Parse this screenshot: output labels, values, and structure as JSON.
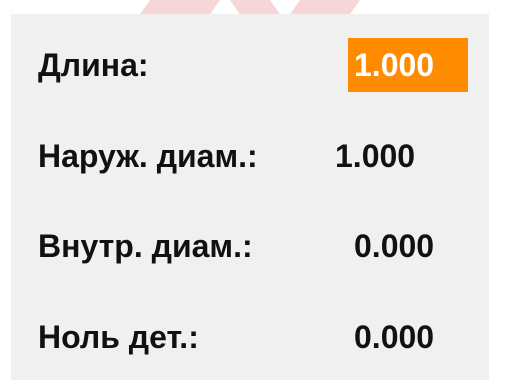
{
  "fields": [
    {
      "label": "Длина:",
      "value": "1.000",
      "selected": true
    },
    {
      "label": "Наруж. диам.:",
      "value": "1.000",
      "selected": false
    },
    {
      "label": "Внутр. диам.:",
      "value": "0.000",
      "selected": false
    },
    {
      "label": "Ноль дет.:",
      "value": "0.000",
      "selected": false
    }
  ],
  "colors": {
    "selection_background": "#ff8c00",
    "panel_background": "#f0f0f0",
    "text": "#111111"
  }
}
